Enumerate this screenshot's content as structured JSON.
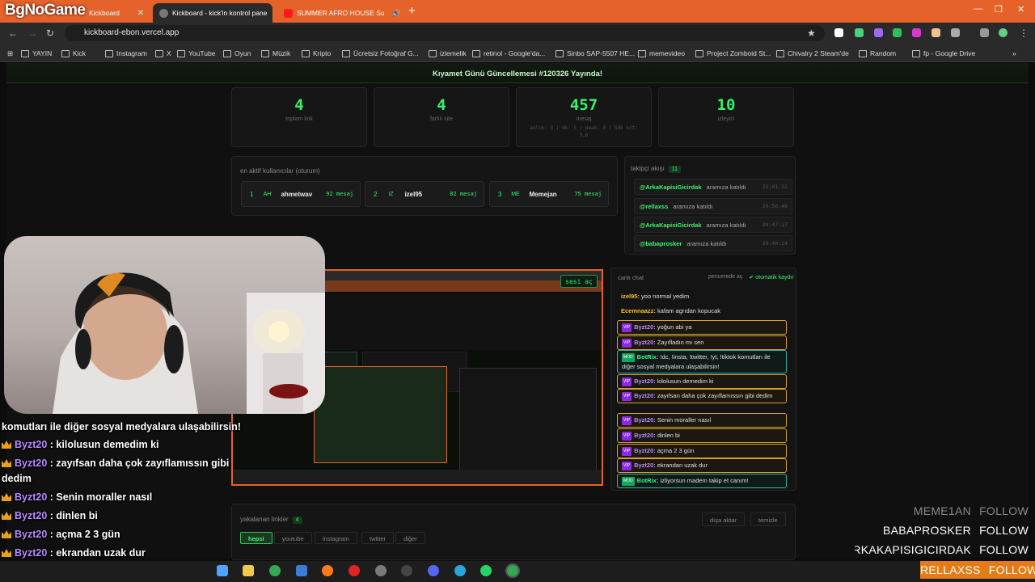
{
  "browser": {
    "tabs": [
      {
        "title": "Kickboard",
        "active": false
      },
      {
        "title": "Kickboard - kick'in kontrol pane",
        "active": true
      },
      {
        "title": "SUMMER AFRO HOUSE Su",
        "active": false
      }
    ],
    "url": "kickboard-ebon.vercel.app",
    "bookmarks": [
      "YAYIN",
      "Kick",
      "Instagram",
      "X",
      "YouTube",
      "Oyun",
      "Müzik",
      "Kripto",
      "Ücretsiz Fotoğraf G...",
      "izlemelik",
      "retinol - Google'da...",
      "Sinbo SAP-5507 HE...",
      "memevideo",
      "Project Zomboid St...",
      "Chivalry 2 Steam'de",
      "Random",
      "fp - Google Drive"
    ],
    "accent": "#e5622a"
  },
  "overlay_brand": "BgNoGame",
  "page": {
    "banner": "Kıyamet Günü Güncellemesi #120326 Yayında!",
    "stats": [
      {
        "value": "4",
        "label": "toplam link",
        "sub": ""
      },
      {
        "value": "4",
        "label": "farklı site",
        "sub": ""
      },
      {
        "value": "457",
        "label": "mesaj",
        "sub": "anlık: 3 | dk: 5 | peak: 8 | 5dk ort: 3,6"
      },
      {
        "value": "10",
        "label": "izleyici",
        "sub": ""
      }
    ],
    "active_users": {
      "title": "en aktif kullanıcılar (oturum)",
      "users": [
        {
          "rank": "1",
          "avatar": "AH",
          "name": "ahmetwav",
          "count": "92 mesaj"
        },
        {
          "rank": "2",
          "avatar": "IZ",
          "name": "izel95",
          "count": "82 mesaj"
        },
        {
          "rank": "3",
          "avatar": "ME",
          "name": "Memejan",
          "count": "75 mesaj"
        }
      ]
    },
    "followers": {
      "title": "takipçi akışı",
      "count": "11",
      "items": [
        {
          "name": "@ArkaKapisiGicirdak",
          "text": "aramıza katıldı",
          "time": "21:01:22"
        },
        {
          "name": "@rellaxss",
          "text": "aramıza katıldı",
          "time": "20:56:46"
        },
        {
          "name": "@ArkaKapisiGicirdak",
          "text": "aramıza katıldı",
          "time": "20:47:17"
        },
        {
          "name": "@babaprosker",
          "text": "aramıza katıldı",
          "time": "20:40:24"
        }
      ]
    },
    "video": {
      "mute_button": "sesi aç"
    },
    "chat": {
      "title": "canlı chat",
      "popout": "pencerede aç",
      "autoscroll": "otomatik kaydır",
      "messages": [
        {
          "user": "izel95:",
          "text": "yoo normal yedim",
          "style": "plain",
          "color": "#f2c230"
        },
        {
          "user": "Ecemnaazz:",
          "text": "kafam agrıdan kopucak",
          "style": "plain",
          "color": "#f2c230"
        },
        {
          "user": "Byzt20:",
          "text": "yoğun abi ya",
          "style": "vip",
          "color": "#b78bff"
        },
        {
          "user": "Byzt20:",
          "text": "Zayıfladın mı sen",
          "style": "vip",
          "color": "#b78bff"
        },
        {
          "user": "BotRix:",
          "text": "!dc, !insta, !twitter, !yt, !tiktok komutları ile diğer sosyal medyalara ulaşabilirsin!",
          "style": "mod",
          "color": "#3cf28a"
        },
        {
          "user": "Byzt20:",
          "text": "kilolusun demedim ki",
          "style": "vip",
          "color": "#b78bff"
        },
        {
          "user": "Byzt20:",
          "text": "zayıfsan daha çok zayıflamıssın gibi dedim",
          "style": "vip",
          "color": "#b78bff"
        },
        {
          "user": "Byzt20:",
          "text": "Senin moraller nasıl",
          "style": "vip",
          "color": "#b78bff"
        },
        {
          "user": "Byzt20:",
          "text": "dinlen bi",
          "style": "vip",
          "color": "#b78bff"
        },
        {
          "user": "Byzt20:",
          "text": "açma 2 3 gün",
          "style": "vip",
          "color": "#b78bff"
        },
        {
          "user": "Byzt20:",
          "text": "ekrandan uzak dur",
          "style": "vip",
          "color": "#b78bff"
        },
        {
          "user": "BotRix:",
          "text": "izliyorsun madem takip et canım!",
          "style": "mod",
          "color": "#3cf28a"
        }
      ],
      "vip_tag": "VIP",
      "mod_tag": "MOD"
    },
    "links": {
      "title": "yakalanan linkler",
      "count": "4",
      "filters": [
        "hepsi",
        "youtube",
        "instagram",
        "twitter",
        "diğer"
      ],
      "export": "dışa aktar",
      "clear": "temizle"
    }
  },
  "stream_overlay": {
    "chat_lines": [
      {
        "user": "",
        "text": "komutları ile diğer sosyal medyalara ulaşabilirsin!"
      },
      {
        "user": "Byzt20",
        "text": ": kilolusun demedim ki"
      },
      {
        "user": "Byzt20",
        "text": ": zayıfsan daha çok zayıflamıssın gibi"
      },
      {
        "user": "",
        "text": "dedim"
      },
      {
        "user": "Byzt20",
        "text": ": Senin moraller nasıl"
      },
      {
        "user": "Byzt20",
        "text": ": dinlen bi"
      },
      {
        "user": "Byzt20",
        "text": ": açma 2 3 gün"
      },
      {
        "user": "Byzt20",
        "text": ": ekrandan uzak dur"
      },
      {
        "user": "BotRix",
        "text": ": izliyorsun madem takip et canım!"
      }
    ],
    "follow_list": [
      {
        "name": "MEME1AN",
        "action": "FOLLOW"
      },
      {
        "name": "BABAPROSKER",
        "action": "FOLLOW"
      },
      {
        "name": "ARKAKAPISIGICIRDAK",
        "action": "FOLLOW"
      },
      {
        "name": "RELLAXSS",
        "action": "FOLLOW"
      }
    ]
  }
}
